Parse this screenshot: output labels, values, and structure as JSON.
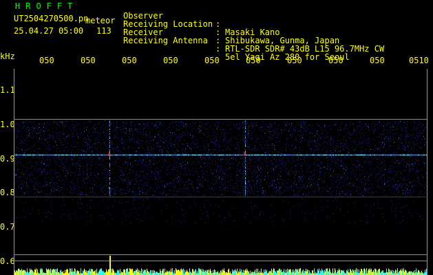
{
  "header": {
    "brand": "HROFFT",
    "filename": "UT2504270500.pn",
    "meteor_label": "meteor",
    "timestamp": "25.04.27 05:00",
    "count": "113",
    "info": [
      {
        "key": "Observer",
        "sep": ":",
        "value": "Masaki Kano"
      },
      {
        "key": "Receiving Location",
        "sep": ":",
        "value": "Shibukawa, Gunma, Japan"
      },
      {
        "key": "Receiver",
        "sep": ":",
        "value": "RTL-SDR SDR# 43dB L15 96.7MHz CW"
      },
      {
        "key": "Receiving Antenna",
        "sep": ":",
        "value": "5el Yagi Az 280 for Seoul"
      }
    ]
  },
  "axes": {
    "y_unit": "kHz",
    "y_ticks": [
      "1.1",
      "1.0",
      "0.9",
      "0.8",
      "0.7",
      "0.6"
    ],
    "x_ticks": [
      "050",
      "050",
      "050",
      "050",
      "050",
      "050",
      "050",
      "050",
      "050",
      "0510"
    ]
  },
  "colors": {
    "brand": "#00ff00",
    "text": "#ffff00",
    "frame": "#9a9a9a",
    "signal_low": "#1a1aa0",
    "signal_mid": "#2e7bff",
    "signal_high": "#20ffff",
    "meteor": "#ff3030",
    "baseline": "#ffff00"
  },
  "spectrum": {
    "band_top_khz": 1.01,
    "band_bottom_khz": 0.79,
    "carrier_khz": 0.91,
    "meteor_minutes": [
      2.3,
      5.6
    ],
    "window_minutes": 10
  }
}
